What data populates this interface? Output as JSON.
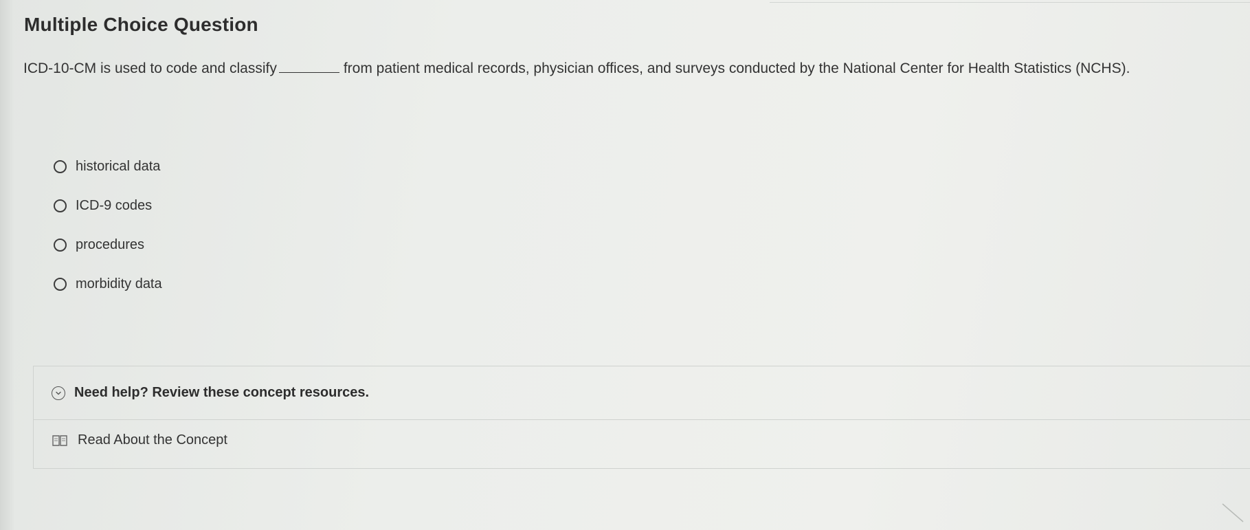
{
  "question": {
    "heading": "Multiple Choice Question",
    "prompt_before": "ICD-10-CM is used to code and classify",
    "prompt_after": "from patient medical records, physician offices, and surveys conducted by the National Center for Health Statistics (NCHS).",
    "options": [
      {
        "label": "historical data"
      },
      {
        "label": "ICD-9 codes"
      },
      {
        "label": "procedures"
      },
      {
        "label": "morbidity data"
      }
    ]
  },
  "help": {
    "title": "Need help? Review these concept resources.",
    "toggle_icon": "chevron-down-icon",
    "resources": [
      {
        "label": "Read About the Concept",
        "icon": "book-icon"
      }
    ]
  },
  "colors": {
    "background": "#eceeeb",
    "text": "#2f2f2f",
    "border": "#cfd2cf"
  }
}
